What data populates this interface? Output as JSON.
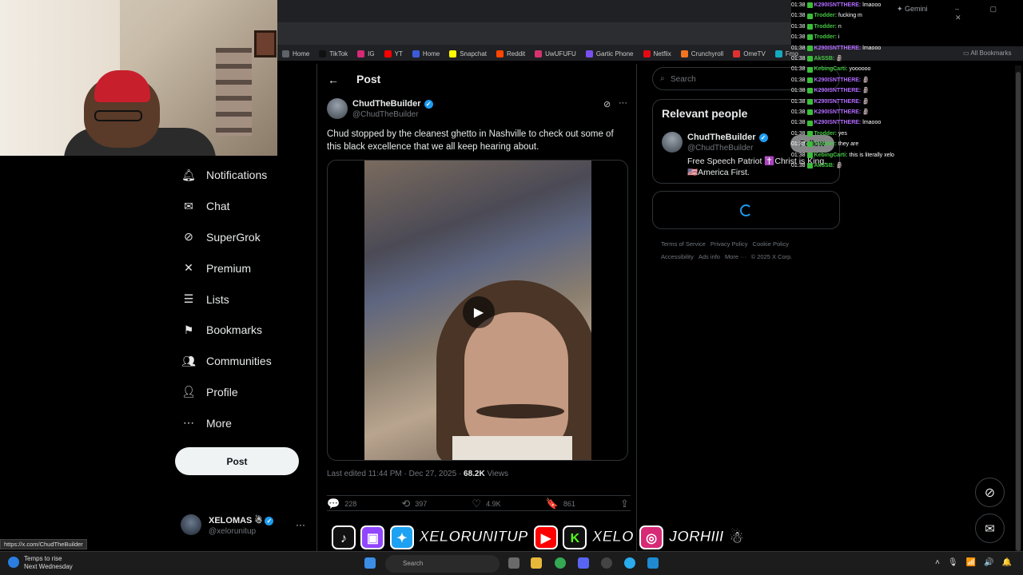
{
  "browser": {
    "gemini_label": "Gemini",
    "window_controls": "– ▢ ✕",
    "bookmarks": [
      {
        "label": "Home",
        "color": "#5f6368"
      },
      {
        "label": "TikTok",
        "color": "#111111"
      },
      {
        "label": "IG",
        "color": "#d62976"
      },
      {
        "label": "YT",
        "color": "#ff0000"
      },
      {
        "label": "Home",
        "color": "#3b5bdb"
      },
      {
        "label": "Snapchat",
        "color": "#fffc00"
      },
      {
        "label": "Reddit",
        "color": "#ff4500"
      },
      {
        "label": "UwUFUFU",
        "color": "#d6336c"
      },
      {
        "label": "Gartic Phone",
        "color": "#7950f2"
      },
      {
        "label": "Netflix",
        "color": "#e50914"
      },
      {
        "label": "Crunchyroll",
        "color": "#f47521"
      },
      {
        "label": "OmeTV",
        "color": "#e03131"
      },
      {
        "label": "Fmo",
        "color": "#15aabf"
      }
    ],
    "all_bookmarks": "All Bookmarks",
    "status_url": "https://x.com/ChudTheBuilder"
  },
  "nav": {
    "items": [
      {
        "label": "Notifications",
        "icon": "bell-icon"
      },
      {
        "label": "Chat",
        "icon": "mail-icon"
      },
      {
        "label": "SuperGrok",
        "icon": "grok-icon"
      },
      {
        "label": "Premium",
        "icon": "x-logo-icon"
      },
      {
        "label": "Lists",
        "icon": "list-icon"
      },
      {
        "label": "Bookmarks",
        "icon": "bookmark-icon"
      },
      {
        "label": "Communities",
        "icon": "people-icon"
      },
      {
        "label": "Profile",
        "icon": "person-icon"
      },
      {
        "label": "More",
        "icon": "more-circle-icon"
      }
    ],
    "post_button": "Post",
    "account": {
      "name": "XELOMAS",
      "handle": "@xelorunitup",
      "more": "···"
    }
  },
  "post": {
    "header_title": "Post",
    "author_name": "ChudTheBuilder",
    "author_handle": "@ChudTheBuilder",
    "text": "Chud stopped by the cleanest ghetto in Nashville to check out some of this black excellence that we all keep hearing about.",
    "meta_prefix": "Last edited 11:44 PM · Dec 27, 2025 · ",
    "views_count": "68.2K",
    "views_label": " Views",
    "stats": {
      "replies": "228",
      "reposts": "397",
      "likes": "4.9K",
      "bookmarks": "861"
    }
  },
  "sidebar_right": {
    "search_placeholder": "Search",
    "relevant_title": "Relevant people",
    "person": {
      "name": "ChudTheBuilder",
      "handle": "@ChudTheBuilder",
      "bio": "Free Speech Patriot ✝️Christ is King. 🇺🇸America First.",
      "follow": "Follow"
    },
    "footer": [
      "Terms of Service",
      "Privacy Policy",
      "Cookie Policy",
      "Accessibility",
      "Ads info",
      "More ···",
      "© 2025 X Corp."
    ]
  },
  "chat": [
    {
      "time": "01:38",
      "user": "K290ISNTTHERE:",
      "color": "#b26bff",
      "msg": "lmaooo"
    },
    {
      "time": "01:38",
      "user": "Trodder:",
      "color": "#45c845",
      "msg": "fucking m"
    },
    {
      "time": "01:38",
      "user": "Trodder:",
      "color": "#45c845",
      "msg": "n"
    },
    {
      "time": "01:38",
      "user": "Trodder:",
      "color": "#45c845",
      "msg": "i"
    },
    {
      "time": "01:38",
      "user": "K290ISNTTHERE:",
      "color": "#b26bff",
      "msg": "lmaooo"
    },
    {
      "time": "01:38",
      "user": "AkSSB:",
      "color": "#45c845",
      "msg": "🗿"
    },
    {
      "time": "01:38",
      "user": "KebingCarti:",
      "color": "#45c845",
      "msg": "yoooooo"
    },
    {
      "time": "01:38",
      "user": "K290ISNTTHERE:",
      "color": "#b26bff",
      "msg": "🗿"
    },
    {
      "time": "01:38",
      "user": "K290ISNTTHERE:",
      "color": "#b26bff",
      "msg": "🗿"
    },
    {
      "time": "01:38",
      "user": "K290ISNTTHERE:",
      "color": "#b26bff",
      "msg": "🗿"
    },
    {
      "time": "01:38",
      "user": "K290ISNTTHERE:",
      "color": "#b26bff",
      "msg": "🗿"
    },
    {
      "time": "01:38",
      "user": "K290ISNTTHERE:",
      "color": "#b26bff",
      "msg": "lmaooo"
    },
    {
      "time": "01:38",
      "user": "Trodder:",
      "color": "#45c845",
      "msg": "yes"
    },
    {
      "time": "01:38",
      "user": "Trodder:",
      "color": "#45c845",
      "msg": "they are"
    },
    {
      "time": "01:38",
      "user": "KebingCarti:",
      "color": "#45c845",
      "msg": "this is literally xelo"
    },
    {
      "time": "01:38",
      "user": "AkSSB:",
      "color": "#45c845",
      "msg": "🗿"
    }
  ],
  "banner": {
    "handle1": "XELORUNITUP",
    "handle2": "XELO",
    "handle3": "JORHIII",
    "logos": [
      "tiktok-logo",
      "twitch-logo",
      "twitter-logo",
      "youtube-logo",
      "kick-logo",
      "instagram-logo"
    ]
  },
  "taskbar": {
    "weather_line1": "Temps to rise",
    "weather_line2": "Next Wednesday",
    "search": "Search"
  }
}
